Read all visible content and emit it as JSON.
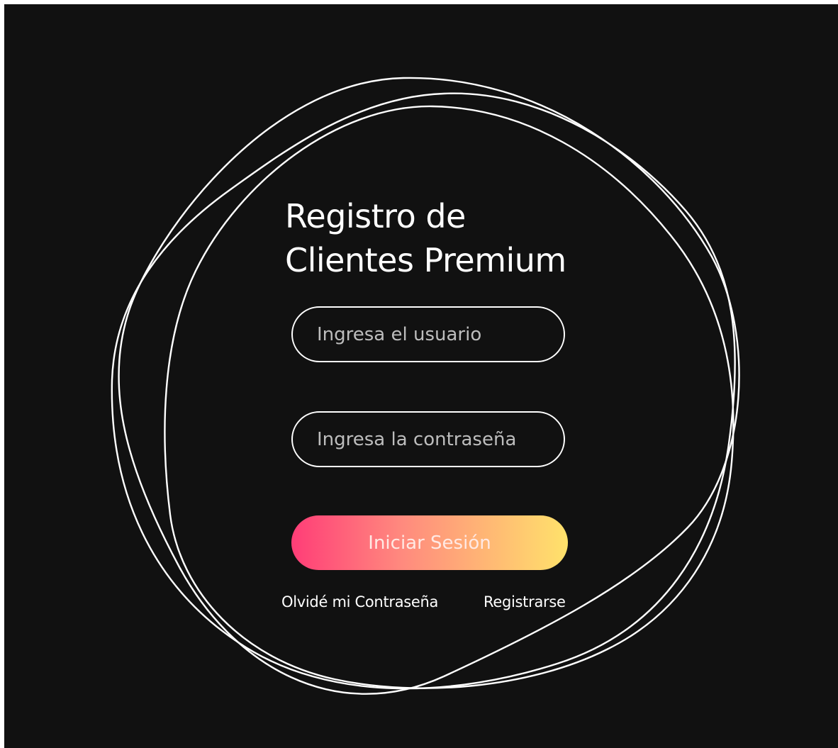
{
  "login": {
    "title_line1": "Registro de",
    "title_line2": "Clientes Premium",
    "username_placeholder": "Ingresa el usuario",
    "password_placeholder": "Ingresa la contraseña",
    "submit_label": "Iniciar Sesión",
    "forgot_label": "Olvidé mi Contraseña",
    "register_label": "Registrarse"
  },
  "colors": {
    "background": "#111111",
    "outline": "#ffffff",
    "button_gradient_start": "#ff3d77",
    "button_gradient_end": "#ffe26b"
  }
}
